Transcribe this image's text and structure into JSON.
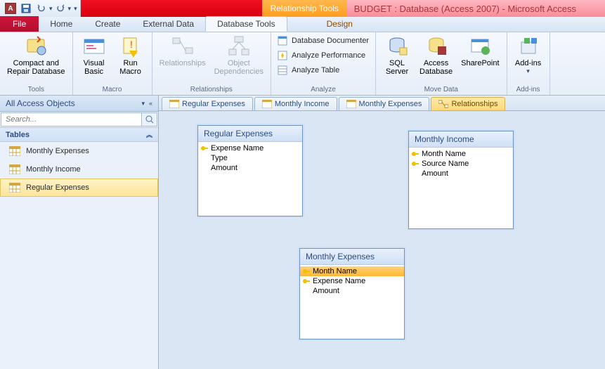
{
  "qat": {
    "app_letter": "A"
  },
  "title": {
    "context_tab": "Relationship Tools",
    "text": "BUDGET : Database (Access 2007)  -  Microsoft Access"
  },
  "tabs": {
    "file": "File",
    "home": "Home",
    "create": "Create",
    "external": "External Data",
    "dbtools": "Database Tools",
    "design": "Design"
  },
  "ribbon": {
    "tools": {
      "compact": "Compact and\nRepair Database",
      "label": "Tools"
    },
    "macro": {
      "vb": "Visual\nBasic",
      "run": "Run\nMacro",
      "label": "Macro"
    },
    "rel": {
      "rel": "Relationships",
      "dep": "Object\nDependencies",
      "label": "Relationships"
    },
    "analyze": {
      "doc": "Database Documenter",
      "perf": "Analyze Performance",
      "tbl": "Analyze Table",
      "label": "Analyze"
    },
    "move": {
      "sql": "SQL\nServer",
      "access": "Access\nDatabase",
      "sp": "SharePoint",
      "label": "Move Data"
    },
    "addins": {
      "btn": "Add-ins",
      "label": "Add-ins"
    }
  },
  "nav": {
    "header": "All Access Objects",
    "search_placeholder": "Search...",
    "section": "Tables",
    "items": [
      "Monthly Expenses",
      "Monthly Income",
      "Regular Expenses"
    ]
  },
  "doctabs": [
    "Regular Expenses",
    "Monthly Income",
    "Monthly Expenses",
    "Relationships"
  ],
  "tables": {
    "regular_expenses": {
      "title": "Regular Expenses",
      "fields": [
        {
          "name": "Expense Name",
          "key": true
        },
        {
          "name": "Type",
          "key": false
        },
        {
          "name": "Amount",
          "key": false
        }
      ]
    },
    "monthly_income": {
      "title": "Monthly Income",
      "fields": [
        {
          "name": "Month Name",
          "key": true
        },
        {
          "name": "Source Name",
          "key": true
        },
        {
          "name": "Amount",
          "key": false
        }
      ]
    },
    "monthly_expenses": {
      "title": "Monthly Expenses",
      "fields": [
        {
          "name": "Month Name",
          "key": true,
          "selected": true
        },
        {
          "name": "Expense Name",
          "key": true
        },
        {
          "name": "Amount",
          "key": false
        }
      ]
    }
  }
}
